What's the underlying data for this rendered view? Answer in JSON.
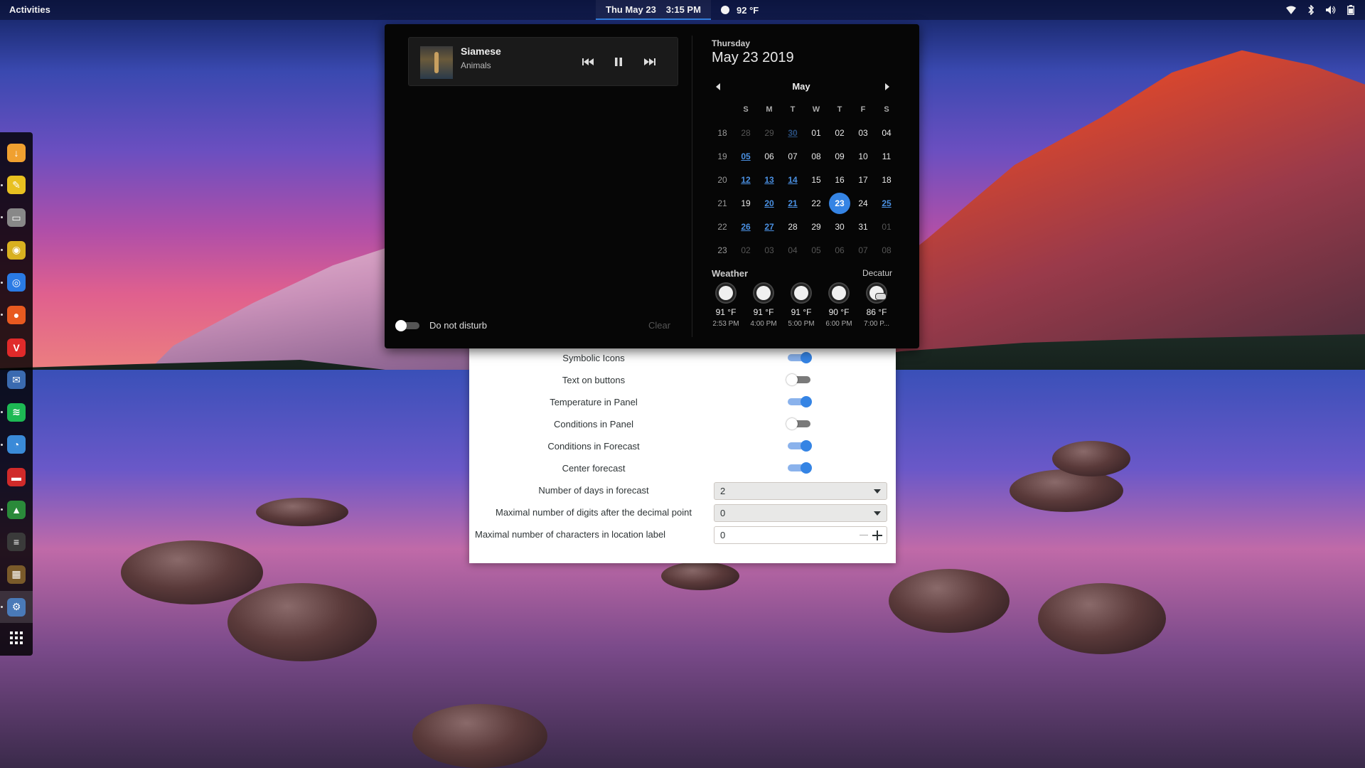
{
  "topbar": {
    "activities": "Activities",
    "date": "Thu May 23",
    "time": "3:15 PM",
    "temperature": "92 °F",
    "tray_icons": [
      "wifi-icon",
      "bluetooth-icon",
      "volume-icon",
      "battery-icon"
    ]
  },
  "dock": {
    "apps": [
      {
        "name": "downloader",
        "icon": "download-arrow-icon",
        "color": "#f0a030",
        "glyph": "↓",
        "running": false,
        "active": false
      },
      {
        "name": "sticky-notes",
        "icon": "notes-icon",
        "color": "#e8c020",
        "glyph": "✎",
        "running": true,
        "active": false
      },
      {
        "name": "files",
        "icon": "folder-icon",
        "color": "#888888",
        "glyph": "▭",
        "running": true,
        "active": false
      },
      {
        "name": "music-player",
        "icon": "speaker-icon",
        "color": "#d8b020",
        "glyph": "◉",
        "running": true,
        "active": false
      },
      {
        "name": "chrome",
        "icon": "chrome-icon",
        "color": "#2a7ae4",
        "glyph": "◎",
        "running": true,
        "active": false
      },
      {
        "name": "firefox",
        "icon": "firefox-icon",
        "color": "#e85a20",
        "glyph": "●",
        "running": true,
        "active": false
      },
      {
        "name": "vivaldi",
        "icon": "vivaldi-icon",
        "color": "#e02a2a",
        "glyph": "V",
        "running": false,
        "active": false
      },
      {
        "name": "mail",
        "icon": "mail-icon",
        "color": "#3a6ab0",
        "glyph": "✉",
        "running": false,
        "active": false
      },
      {
        "name": "spotify",
        "icon": "spotify-icon",
        "color": "#1db954",
        "glyph": "≋",
        "running": true,
        "active": false
      },
      {
        "name": "chat",
        "icon": "chat-bird-icon",
        "color": "#3a8ad8",
        "glyph": "◔",
        "running": true,
        "active": false
      },
      {
        "name": "media-recorder",
        "icon": "cassette-icon",
        "color": "#d02a2a",
        "glyph": "▬",
        "running": false,
        "active": false
      },
      {
        "name": "system-monitor",
        "icon": "monitor-graph-icon",
        "color": "#2a8a3a",
        "glyph": "▲",
        "running": true,
        "active": false
      },
      {
        "name": "terminal",
        "icon": "terminal-icon",
        "color": "#3a3a3a",
        "glyph": "≡",
        "running": false,
        "active": false
      },
      {
        "name": "minecraft",
        "icon": "minecraft-icon",
        "color": "#7a5a2a",
        "glyph": "▦",
        "running": false,
        "active": false
      },
      {
        "name": "settings",
        "icon": "settings-gear-icon",
        "color": "#4a7ab8",
        "glyph": "⚙",
        "running": true,
        "active": true
      }
    ],
    "show_apps_icon": "app-grid-icon"
  },
  "media": {
    "title": "Siamese",
    "artist": "Animals",
    "prev_icon": "previous-track-icon",
    "pause_icon": "pause-icon",
    "next_icon": "next-track-icon"
  },
  "notifications": {
    "dnd_label": "Do not disturb",
    "dnd_on": false,
    "clear_label": "Clear"
  },
  "calendar": {
    "day_name": "Thursday",
    "full_date": "May 23 2019",
    "month": "May",
    "weekday_headers": [
      "S",
      "M",
      "T",
      "W",
      "T",
      "F",
      "S"
    ],
    "weeks": [
      {
        "num": "18",
        "days": [
          {
            "d": "28",
            "o": true
          },
          {
            "d": "29",
            "o": true
          },
          {
            "d": "30",
            "o": true,
            "w": true
          },
          {
            "d": "01"
          },
          {
            "d": "02"
          },
          {
            "d": "03"
          },
          {
            "d": "04"
          }
        ]
      },
      {
        "num": "19",
        "days": [
          {
            "d": "05",
            "w": true
          },
          {
            "d": "06"
          },
          {
            "d": "07"
          },
          {
            "d": "08"
          },
          {
            "d": "09"
          },
          {
            "d": "10"
          },
          {
            "d": "11"
          }
        ]
      },
      {
        "num": "20",
        "days": [
          {
            "d": "12",
            "w": true
          },
          {
            "d": "13",
            "w": true
          },
          {
            "d": "14",
            "w": true
          },
          {
            "d": "15"
          },
          {
            "d": "16"
          },
          {
            "d": "17"
          },
          {
            "d": "18"
          }
        ]
      },
      {
        "num": "21",
        "days": [
          {
            "d": "19"
          },
          {
            "d": "20",
            "w": true
          },
          {
            "d": "21",
            "w": true
          },
          {
            "d": "22"
          },
          {
            "d": "23",
            "today": true
          },
          {
            "d": "24"
          },
          {
            "d": "25",
            "w": true
          }
        ]
      },
      {
        "num": "22",
        "days": [
          {
            "d": "26",
            "w": true
          },
          {
            "d": "27",
            "w": true
          },
          {
            "d": "28"
          },
          {
            "d": "29"
          },
          {
            "d": "30"
          },
          {
            "d": "31"
          },
          {
            "d": "01",
            "o": true
          }
        ]
      },
      {
        "num": "23",
        "days": [
          {
            "d": "02",
            "o": true
          },
          {
            "d": "03",
            "o": true
          },
          {
            "d": "04",
            "o": true
          },
          {
            "d": "05",
            "o": true
          },
          {
            "d": "06",
            "o": true
          },
          {
            "d": "07",
            "o": true
          },
          {
            "d": "08",
            "o": true
          }
        ]
      }
    ]
  },
  "weather": {
    "title": "Weather",
    "location": "Decatur",
    "forecast": [
      {
        "temp": "91 °F",
        "time": "2:53 PM",
        "icon": "clear-sun-icon"
      },
      {
        "temp": "91 °F",
        "time": "4:00 PM",
        "icon": "clear-sun-icon"
      },
      {
        "temp": "91 °F",
        "time": "5:00 PM",
        "icon": "clear-sun-icon"
      },
      {
        "temp": "90 °F",
        "time": "6:00 PM",
        "icon": "clear-sun-icon"
      },
      {
        "temp": "86 °F",
        "time": "7:00 P...",
        "icon": "partly-cloudy-icon"
      }
    ]
  },
  "settings": {
    "rows": [
      {
        "label": "Symbolic Icons",
        "type": "toggle",
        "on": true
      },
      {
        "label": "Text on buttons",
        "type": "toggle",
        "on": false
      },
      {
        "label": "Temperature in Panel",
        "type": "toggle",
        "on": true
      },
      {
        "label": "Conditions in Panel",
        "type": "toggle",
        "on": false
      },
      {
        "label": "Conditions in Forecast",
        "type": "toggle",
        "on": true
      },
      {
        "label": "Center forecast",
        "type": "toggle",
        "on": true
      },
      {
        "label": "Number of days in forecast",
        "type": "combo",
        "value": "2"
      },
      {
        "label": "Maximal number of digits after the decimal point",
        "type": "combo",
        "value": "0"
      },
      {
        "label": "Maximal number of characters in location label",
        "type": "spin",
        "value": "0"
      }
    ],
    "accent": "#3584e4"
  }
}
